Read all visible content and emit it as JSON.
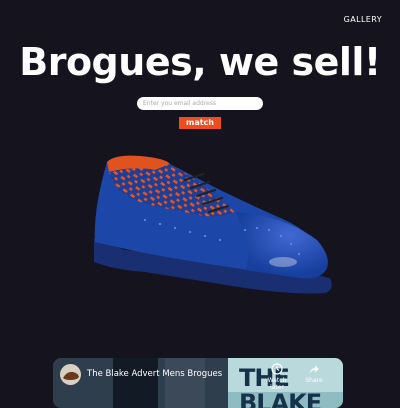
{
  "nav": {
    "gallery_label": "GALLERY"
  },
  "hero": {
    "title": "Brogues, we sell!"
  },
  "signup": {
    "email_placeholder": "Enter you email address",
    "submit_label": "match"
  },
  "video": {
    "title": "The Blake Advert Mens Brogues",
    "overlay_text_line1": "THE",
    "overlay_text_line2": "BLAKE",
    "actions": {
      "watch_later_label": "Watch later",
      "share_label": "Share"
    }
  },
  "colors": {
    "background": "#15131e",
    "accent": "#ee4e1e",
    "shoe_blue": "#1c47a8",
    "shoe_lining": "#e0531e"
  },
  "icons": [
    "clock-icon",
    "share-icon"
  ]
}
